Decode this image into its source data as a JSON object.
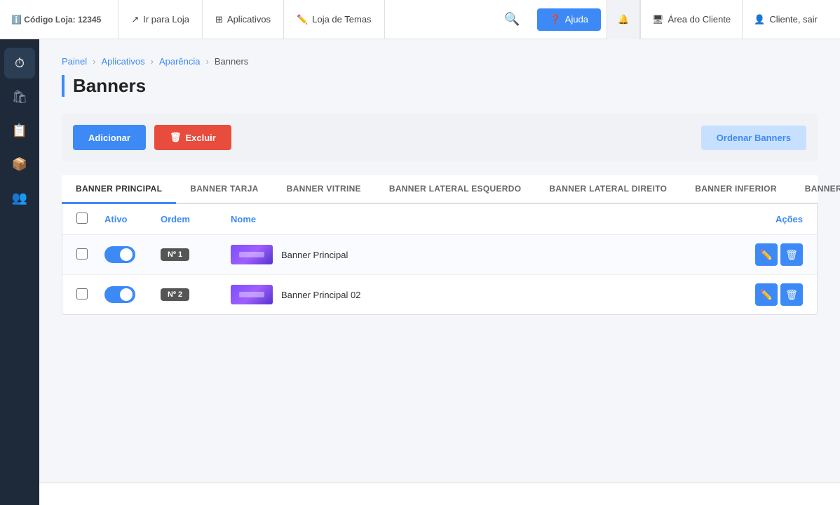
{
  "topbar": {
    "store_code_label": "Código Loja:",
    "store_code": "12345",
    "nav_items": [
      {
        "id": "ir-loja",
        "label": "Ir para Loja",
        "icon": "external-link"
      },
      {
        "id": "aplicativos",
        "label": "Aplicativos",
        "icon": "grid"
      },
      {
        "id": "loja-temas",
        "label": "Loja de Temas",
        "icon": "pencil"
      }
    ],
    "help_button": "Ajuda",
    "area_cliente": "Área do Cliente",
    "user_label": "Cliente, sair"
  },
  "sidebar": {
    "items": [
      {
        "id": "dashboard",
        "icon": "⏱"
      },
      {
        "id": "shop",
        "icon": "🛍"
      },
      {
        "id": "orders",
        "icon": "📋"
      },
      {
        "id": "box",
        "icon": "📦"
      },
      {
        "id": "users",
        "icon": "👥"
      }
    ]
  },
  "breadcrumb": {
    "items": [
      {
        "label": "Painel",
        "href": "#"
      },
      {
        "label": "Aplicativos",
        "href": "#"
      },
      {
        "label": "Aparência",
        "href": "#"
      },
      {
        "label": "Banners",
        "current": true
      }
    ]
  },
  "page_title": "Banners",
  "toolbar": {
    "add_button": "Adicionar",
    "delete_button": "Excluir",
    "order_button": "Ordenar Banners"
  },
  "tabs": [
    {
      "id": "banner-principal",
      "label": "BANNER PRINCIPAL",
      "active": true
    },
    {
      "id": "banner-tarja",
      "label": "BANNER TARJA",
      "active": false
    },
    {
      "id": "banner-vitrine",
      "label": "BANNER VITRINE",
      "active": false
    },
    {
      "id": "banner-lateral-esquerdo",
      "label": "BANNER LATERAL ESQUERDO",
      "active": false
    },
    {
      "id": "banner-lateral-direito",
      "label": "BANNER LATERAL DIREITO",
      "active": false
    },
    {
      "id": "banner-inferior",
      "label": "BANNER INFERIOR",
      "active": false
    },
    {
      "id": "banner-mobile",
      "label": "BANNER MOBILE",
      "active": false
    }
  ],
  "table": {
    "headers": {
      "ativo": "Ativo",
      "ordem": "Ordem",
      "nome": "Nome",
      "acoes": "Ações"
    },
    "rows": [
      {
        "id": 1,
        "ativo": true,
        "ordem": "Nº 1",
        "nome": "Banner Principal"
      },
      {
        "id": 2,
        "ativo": true,
        "ordem": "Nº 2",
        "nome": "Banner Principal 02"
      }
    ]
  }
}
